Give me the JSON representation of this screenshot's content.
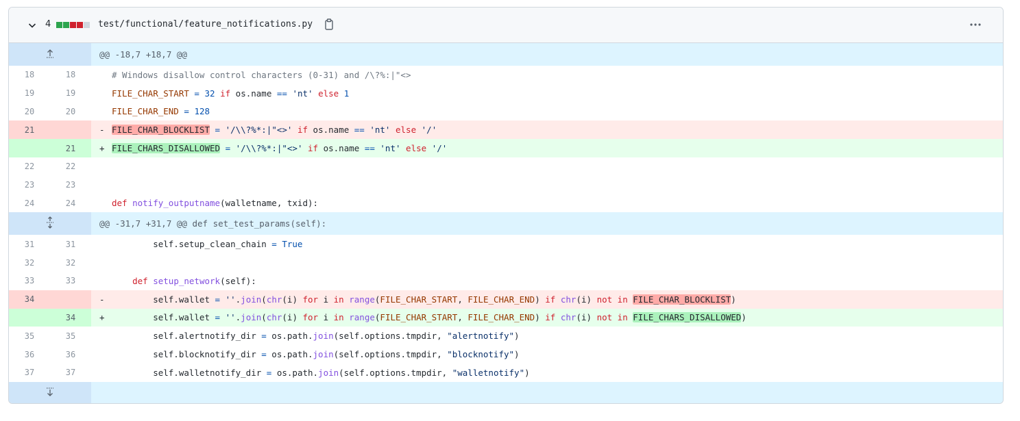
{
  "header": {
    "change_count": "4",
    "blocks": [
      "#2da44e",
      "#2da44e",
      "#cf222e",
      "#cf222e",
      "#d0d7de"
    ],
    "filename": "test/functional/feature_notifications.py",
    "icons": {
      "expand": "chevron-down-icon",
      "copy": "copy-icon",
      "menu": "kebab-horizontal-icon"
    }
  },
  "hunks": [
    {
      "header": "@@ -18,7 +18,7 @@",
      "expand_icon": "expand-up-icon"
    },
    {
      "header": "@@ -31,7 +31,7 @@ def set_test_params(self):",
      "expand_icon": "expand-both-icon"
    }
  ],
  "lines": [
    {
      "old": "18",
      "new": "18",
      "text": "# Windows disallow control characters (0-31) and /\\?%:|\"<>"
    },
    {
      "old": "19",
      "new": "19",
      "text": "FILE_CHAR_START = 32 if os.name == 'nt' else 1"
    },
    {
      "old": "20",
      "new": "20",
      "text": "FILE_CHAR_END = 128"
    },
    {
      "old": "21",
      "new": "",
      "marker": "-",
      "hl": "FILE_CHAR_BLOCKLIST",
      "text": " = '/\\\\?%*:|\"<>' if os.name == 'nt' else '/'"
    },
    {
      "old": "",
      "new": "21",
      "marker": "+",
      "hl": "FILE_CHARS_DISALLOWED",
      "text": " = '/\\\\?%*:|\"<>' if os.name == 'nt' else '/'"
    },
    {
      "old": "22",
      "new": "22",
      "text": ""
    },
    {
      "old": "23",
      "new": "23",
      "text": ""
    },
    {
      "old": "24",
      "new": "24",
      "text": "def notify_outputname(walletname, txid):"
    },
    {
      "old": "31",
      "new": "31",
      "text": "        self.setup_clean_chain = True"
    },
    {
      "old": "32",
      "new": "32",
      "text": ""
    },
    {
      "old": "33",
      "new": "33",
      "text": "    def setup_network(self):"
    },
    {
      "old": "34",
      "new": "",
      "marker": "-",
      "text": "        self.wallet = ''.join(chr(i) for i in range(FILE_CHAR_START, FILE_CHAR_END) if chr(i) not in ",
      "hl": "FILE_CHAR_BLOCKLIST",
      "tail": ")"
    },
    {
      "old": "",
      "new": "34",
      "marker": "+",
      "text": "        self.wallet = ''.join(chr(i) for i in range(FILE_CHAR_START, FILE_CHAR_END) if chr(i) not in ",
      "hl": "FILE_CHARS_DISALLOWED",
      "tail": ")"
    },
    {
      "old": "35",
      "new": "35",
      "text": "        self.alertnotify_dir = os.path.join(self.options.tmpdir, \"alertnotify\")"
    },
    {
      "old": "36",
      "new": "36",
      "text": "        self.blocknotify_dir = os.path.join(self.options.tmpdir, \"blocknotify\")"
    },
    {
      "old": "37",
      "new": "37",
      "text": "        self.walletnotify_dir = os.path.join(self.options.tmpdir, \"walletnotify\")"
    }
  ],
  "footer": {
    "expand_icon": "expand-down-icon"
  }
}
